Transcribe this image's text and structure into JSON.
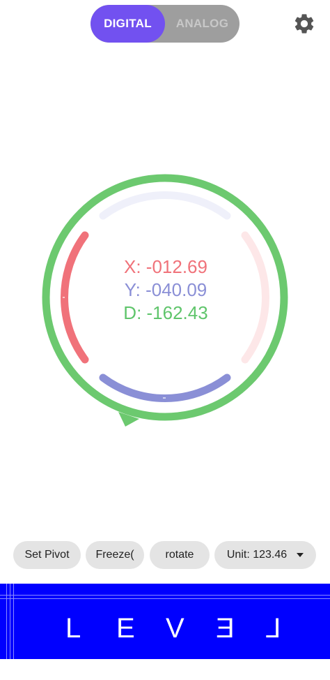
{
  "mode_toggle": {
    "digital_label": "DIGITAL",
    "analog_label": "ANALOG",
    "selected": "DIGITAL"
  },
  "settings_icon": "gear-icon",
  "readouts": {
    "x": "X: -012.69",
    "y": "Y: -040.09",
    "d": "D: -162.43"
  },
  "colors": {
    "x_axis": "#f0727a",
    "y_axis": "#8a8fd6",
    "d_ring": "#6cc96f",
    "accent": "#7251f0",
    "banner_bg": "#0000ff"
  },
  "controls": {
    "set_pivot": "Set Pivot",
    "freeze": "Freeze(",
    "rotate": "rotate",
    "unit": "Unit: 123.46"
  },
  "banner": {
    "letters": [
      "L",
      "E",
      "V",
      "E",
      "L"
    ]
  }
}
